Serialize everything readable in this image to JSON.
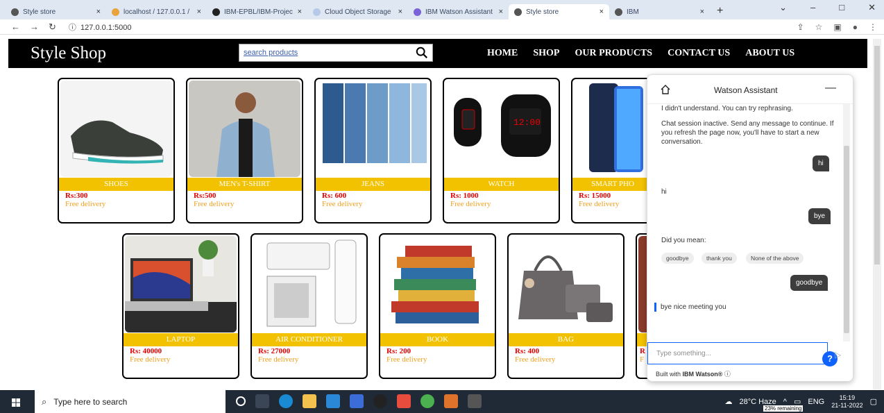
{
  "browser": {
    "tabs": [
      {
        "title": "Style store"
      },
      {
        "title": "localhost / 127.0.0.1 /"
      },
      {
        "title": "IBM-EPBL/IBM-Projec"
      },
      {
        "title": "Cloud Object Storage"
      },
      {
        "title": "IBM Watson Assistant"
      },
      {
        "title": "Style store",
        "active": true
      },
      {
        "title": "IBM"
      }
    ],
    "url": "127.0.0.1:5000"
  },
  "site": {
    "logo": "Style Shop",
    "search_placeholder": "search products",
    "menu": [
      "HOME",
      "SHOP",
      "OUR PRODUCTS",
      "CONTACT US",
      "ABOUT US"
    ]
  },
  "products": [
    {
      "name": "SHOES",
      "price": "Rs:300",
      "delivery": "Free delivery"
    },
    {
      "name": "MEN's T-SHIRT",
      "price": "Rs:500",
      "delivery": "Free delivery"
    },
    {
      "name": "JEANS",
      "price": "Rs: 600",
      "delivery": "Free delivery"
    },
    {
      "name": "WATCH",
      "price": "Rs: 1000",
      "delivery": "Free delivery"
    },
    {
      "name": "SMART PHO",
      "price": "Rs: 15000",
      "delivery": "Free delivery"
    },
    {
      "name": "LAPTOP",
      "price": "Rs: 40000",
      "delivery": "Free delivery"
    },
    {
      "name": "AIR CONDITIONER",
      "price": "Rs: 27000",
      "delivery": "Free delivery"
    },
    {
      "name": "BOOK",
      "price": "Rs: 200",
      "delivery": "Free delivery"
    },
    {
      "name": "BAG",
      "price": "Rs: 400",
      "delivery": "Free delivery"
    },
    {
      "name": "",
      "price": "R",
      "delivery": "F"
    }
  ],
  "chat": {
    "title": "Watson Assistant",
    "messages": {
      "bot1": "I didn't understand. You can try rephrasing.",
      "bot2": "Chat session inactive. Send any message to continue. If you refresh the page now, you'll have to start a new conversation.",
      "user1": "hi",
      "bot3": "hi",
      "user2": "bye",
      "bot4": "Did you mean:",
      "chips": [
        "goodbye",
        "thank you",
        "None of the above"
      ],
      "user3": "goodbye",
      "bot5": "bye nice meeting you"
    },
    "help": "?",
    "input_placeholder": "Type something...",
    "footer_prefix": "Built with",
    "footer_brand": "IBM Watson®"
  },
  "taskbar": {
    "search_placeholder": "Type here to search",
    "weather": "28°C  Haze",
    "time": "15:19",
    "date": "21-11-2022",
    "battery": "23% remaining",
    "lang": "ENG"
  },
  "colors": {
    "accent_bar": "#f2c200",
    "price": "#e00000",
    "delivery": "#f0a020",
    "watson_blue": "#0f62fe"
  }
}
